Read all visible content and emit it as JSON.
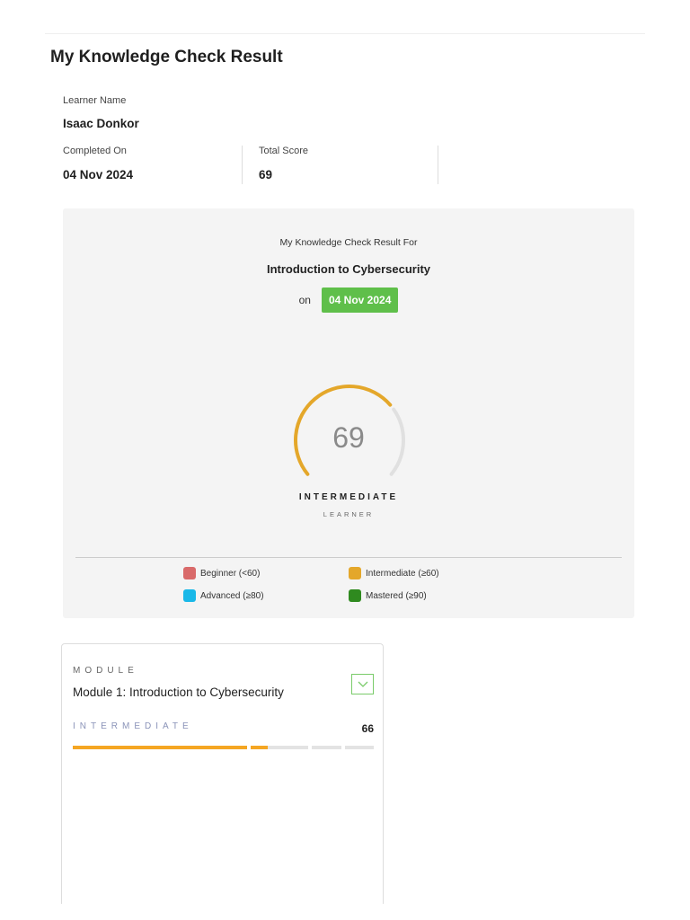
{
  "page_title": "My Knowledge Check Result",
  "learner": {
    "name_label": "Learner Name",
    "name": "Isaac Donkor",
    "completed_label": "Completed On",
    "completed": "04 Nov 2024",
    "score_label": "Total Score",
    "score": "69"
  },
  "result": {
    "heading": "My Knowledge Check Result For",
    "course": "Introduction to Cybersecurity",
    "on_label": "on",
    "date": "04 Nov 2024",
    "score": 69,
    "score_text": "69",
    "level": "INTERMEDIATE",
    "level_sub": "LEARNER",
    "gauge_color": "#e4a72a",
    "track_color": "#e0e0e0"
  },
  "legend": [
    {
      "label": "Beginner (<60)",
      "color": "#d96a6a"
    },
    {
      "label": "Intermediate (≥60)",
      "color": "#e4a72a"
    },
    {
      "label": "Advanced (≥80)",
      "color": "#19b8e8"
    },
    {
      "label": "Mastered (≥90)",
      "color": "#2f8a1f"
    }
  ],
  "module": {
    "kicker": "MODULE",
    "title": "Module 1: Introduction to Cybersecurity",
    "level": "INTERMEDIATE",
    "score": "66",
    "score_value": 66,
    "bar_color": "#f5a623"
  }
}
